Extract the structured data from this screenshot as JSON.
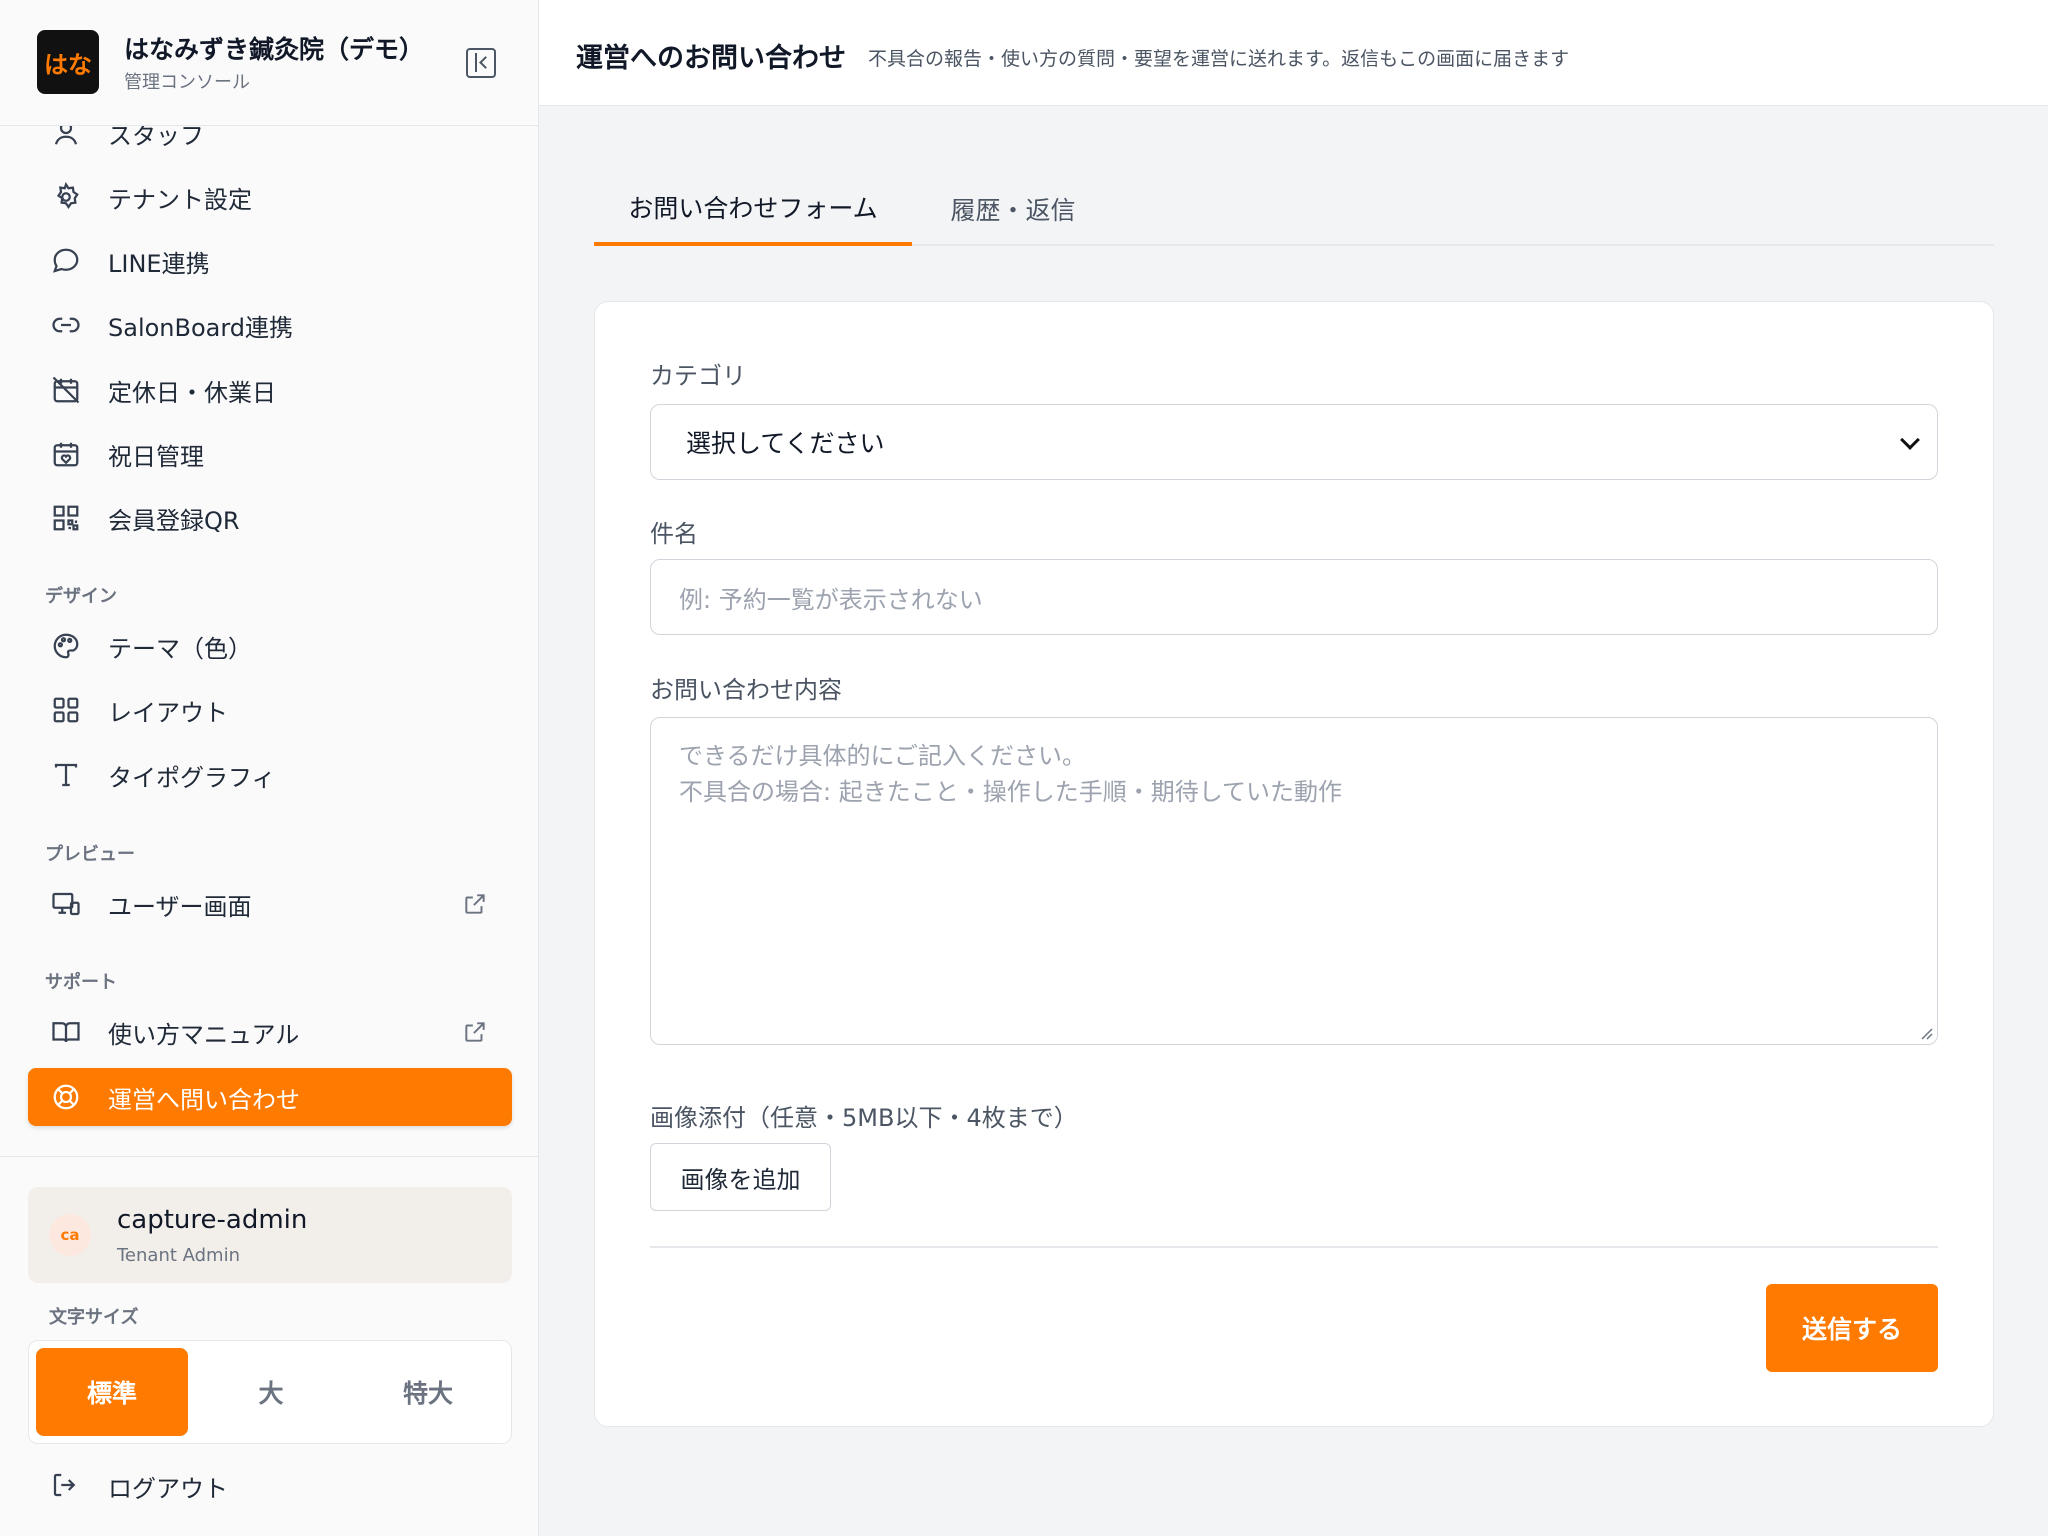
{
  "brand": {
    "logo_text": "はな",
    "name": "はなみずき鍼灸院（デモ）",
    "subtitle": "管理コンソール"
  },
  "sidebar": {
    "items": [
      {
        "label": "スタッフ",
        "icon": "user-icon"
      },
      {
        "label": "テナント設定",
        "icon": "gear-icon"
      },
      {
        "label": "LINE連携",
        "icon": "chat-bubble-icon"
      },
      {
        "label": "SalonBoard連携",
        "icon": "link-icon"
      },
      {
        "label": "定休日・休業日",
        "icon": "calendar-off-icon"
      },
      {
        "label": "祝日管理",
        "icon": "calendar-heart-icon"
      },
      {
        "label": "会員登録QR",
        "icon": "qr-code-icon"
      }
    ],
    "section_design": "デザイン",
    "design_items": [
      {
        "label": "テーマ（色）",
        "icon": "palette-icon"
      },
      {
        "label": "レイアウト",
        "icon": "grid-icon"
      },
      {
        "label": "タイポグラフィ",
        "icon": "type-icon"
      }
    ],
    "section_preview": "プレビュー",
    "preview_items": [
      {
        "label": "ユーザー画面",
        "icon": "monitor-icon"
      }
    ],
    "section_support": "サポート",
    "support_items": [
      {
        "label": "使い方マニュアル",
        "icon": "book-icon"
      },
      {
        "label": "運営へ問い合わせ",
        "icon": "lifebuoy-icon",
        "active": true
      }
    ]
  },
  "user": {
    "avatar": "ca",
    "name": "capture-admin",
    "role": "Tenant Admin"
  },
  "font_size": {
    "label": "文字サイズ",
    "options": [
      "標準",
      "大",
      "特大"
    ],
    "selected": "標準"
  },
  "logout_label": "ログアウト",
  "header": {
    "title": "運営へのお問い合わせ",
    "description": "不具合の報告・使い方の質問・要望を運営に送れます。返信もこの画面に届きます"
  },
  "tabs": [
    {
      "label": "お問い合わせフォーム",
      "active": true
    },
    {
      "label": "履歴・返信",
      "active": false
    }
  ],
  "form": {
    "category_label": "カテゴリ",
    "category_value": "選択してください",
    "subject_label": "件名",
    "subject_placeholder": "例: 予約一覧が表示されない",
    "body_label": "お問い合わせ内容",
    "body_placeholder_line1": "できるだけ具体的にご記入ください。",
    "body_placeholder_line2": "不具合の場合: 起きたこと・操作した手順・期待していた動作",
    "image_label": "画像添付（任意・5MB以下・4枚まで）",
    "add_image_label": "画像を追加",
    "submit_label": "送信する"
  },
  "colors": {
    "accent": "#ff7a00",
    "sidebar_bg": "#fafafa",
    "main_bg": "#f3f4f6"
  }
}
